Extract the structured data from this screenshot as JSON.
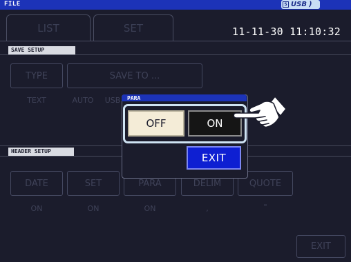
{
  "titlebar": {
    "title": "FILE",
    "usb_label": "USB",
    "sd_glyph": "S"
  },
  "tabs": [
    {
      "label": "LIST"
    },
    {
      "label": "SET"
    }
  ],
  "datetime": "11-11-30 11:10:32",
  "save_setup": {
    "section_label": "SAVE SETUP",
    "type_button": "TYPE",
    "type_value": "TEXT",
    "save_to_button": "SAVE TO ...",
    "save_to_value_auto": "AUTO",
    "save_to_value_usb": "USB"
  },
  "header_setup": {
    "section_label": "HEADER SETUP",
    "items": [
      {
        "label": "DATE",
        "value": "ON"
      },
      {
        "label": "SET",
        "value": "ON"
      },
      {
        "label": "PARA",
        "value": "ON"
      },
      {
        "label": "DELIM",
        "value": ","
      },
      {
        "label": "QUOTE",
        "value": "\""
      }
    ]
  },
  "popup": {
    "title": "PARA",
    "off_label": "OFF",
    "on_label": "ON",
    "exit_label": "EXIT",
    "selected": "ON"
  },
  "footer": {
    "exit_label": "EXIT"
  },
  "colors": {
    "titlebar": "#1c33b8",
    "background": "#1b1c2c",
    "exit_accent": "#0e1fd2",
    "off_button": "#f4ecd7",
    "highlight": "#cfe3f3"
  }
}
